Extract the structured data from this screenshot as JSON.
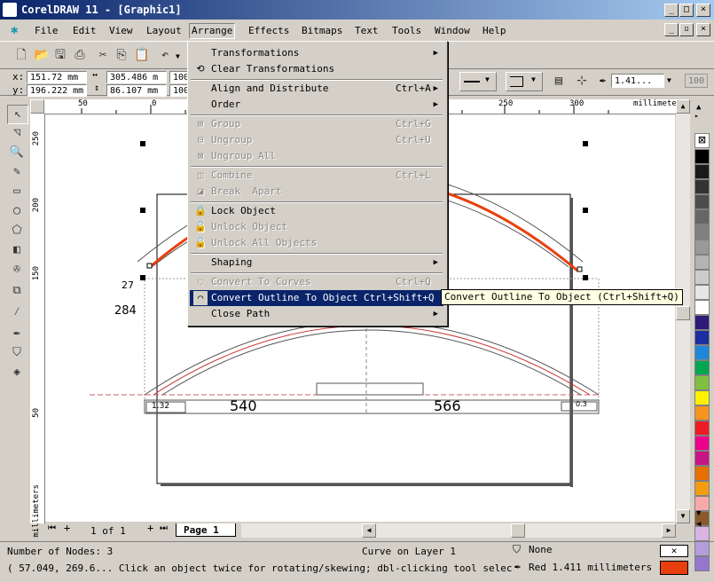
{
  "window": {
    "title": "CorelDRAW 11 - [Graphic1]"
  },
  "menubar": {
    "items": [
      "File",
      "Edit",
      "View",
      "Layout",
      "Arrange",
      "Effects",
      "Bitmaps",
      "Text",
      "Tools",
      "Window",
      "Help"
    ],
    "active": "Arrange"
  },
  "propbar": {
    "x_label": "x:",
    "x_value": "151.72 mm",
    "y_label": "y:",
    "y_value": "196.222 mm",
    "w_value": "305.486 m",
    "h_value": "86.107 mm",
    "scale_x": "100",
    "scale_y": "100",
    "outline_width": "1.41...",
    "zoom_field": "100"
  },
  "ruler": {
    "h_ticks": [
      "50",
      "0",
      "250",
      "300"
    ],
    "h_unit": "millimeters",
    "v_ticks": [
      "250",
      "200",
      "150",
      "50"
    ],
    "v_unit": "millimeters"
  },
  "drawing": {
    "dim_27": "27",
    "dim_284": "284",
    "dim_540": "540",
    "dim_566": "566",
    "dim_small_left": "1.32",
    "dim_small_right": "0.3"
  },
  "arrange_menu": {
    "items": [
      {
        "label": "Transformations",
        "shortcut": "",
        "submenu": true,
        "disabled": false,
        "icon": ""
      },
      {
        "label": "Clear Transformations",
        "shortcut": "",
        "submenu": false,
        "disabled": false,
        "icon": "clear-transformations-icon"
      },
      {
        "label": "Align and Distribute",
        "shortcut": "Ctrl+A",
        "submenu": true,
        "disabled": false,
        "icon": ""
      },
      {
        "label": "Order",
        "shortcut": "",
        "submenu": true,
        "disabled": false,
        "icon": ""
      },
      {
        "label": "Group",
        "shortcut": "Ctrl+G",
        "submenu": false,
        "disabled": true,
        "icon": "group-icon"
      },
      {
        "label": "Ungroup",
        "shortcut": "Ctrl+U",
        "submenu": false,
        "disabled": true,
        "icon": "ungroup-icon"
      },
      {
        "label": "Ungroup All",
        "shortcut": "",
        "submenu": false,
        "disabled": true,
        "icon": "ungroup-all-icon"
      },
      {
        "label": "Combine",
        "shortcut": "Ctrl+L",
        "submenu": false,
        "disabled": true,
        "icon": "combine-icon"
      },
      {
        "label": "Break  Apart",
        "shortcut": "",
        "submenu": false,
        "disabled": true,
        "icon": "break-apart-icon"
      },
      {
        "label": "Lock Object",
        "shortcut": "",
        "submenu": false,
        "disabled": false,
        "icon": "lock-icon"
      },
      {
        "label": "Unlock Object",
        "shortcut": "",
        "submenu": false,
        "disabled": true,
        "icon": "unlock-icon"
      },
      {
        "label": "Unlock All Objects",
        "shortcut": "",
        "submenu": false,
        "disabled": true,
        "icon": "unlock-all-icon"
      },
      {
        "label": "Shaping",
        "shortcut": "",
        "submenu": true,
        "disabled": false,
        "icon": ""
      },
      {
        "label": "Convert To Curves",
        "shortcut": "Ctrl+Q",
        "submenu": false,
        "disabled": true,
        "icon": "convert-to-curves-icon"
      },
      {
        "label": "Convert Outline To Object",
        "shortcut": "Ctrl+Shift+Q",
        "submenu": false,
        "disabled": false,
        "highlighted": true,
        "icon": "convert-outline-icon"
      },
      {
        "label": "Close Path",
        "shortcut": "",
        "submenu": true,
        "disabled": false,
        "icon": ""
      }
    ]
  },
  "tooltip": "Convert Outline To Object (Ctrl+Shift+Q)",
  "page_nav": {
    "position": "1 of 1",
    "tab": "Page 1"
  },
  "status": {
    "nodes": "Number of Nodes: 3",
    "layer": "Curve on Layer 1",
    "hint": "( 57.049, 269.6...   Click an object twice for rotating/skewing; dbl-clicking tool selects al...",
    "fill": "None",
    "outline": "Red  1.411 millimeters"
  },
  "colors": {
    "outline_red": "#e8400c",
    "highlight": "#0a246a",
    "palette": [
      "#000000",
      "#1a1a1a",
      "#333333",
      "#4d4d4d",
      "#666666",
      "#808080",
      "#999999",
      "#b3b3b3",
      "#cccccc",
      "#e6e6e6",
      "#ffffff",
      "#2e1a78",
      "#1c2fa0",
      "#1e88d8",
      "#00a650",
      "#80c040",
      "#fff200",
      "#f7941d",
      "#ed1c24",
      "#ec008c",
      "#c71585",
      "#e76f00",
      "#f39c12",
      "#f5a9a9",
      "#8b5a2b",
      "#d8b4e2",
      "#b39ddb",
      "#9575cd"
    ]
  }
}
